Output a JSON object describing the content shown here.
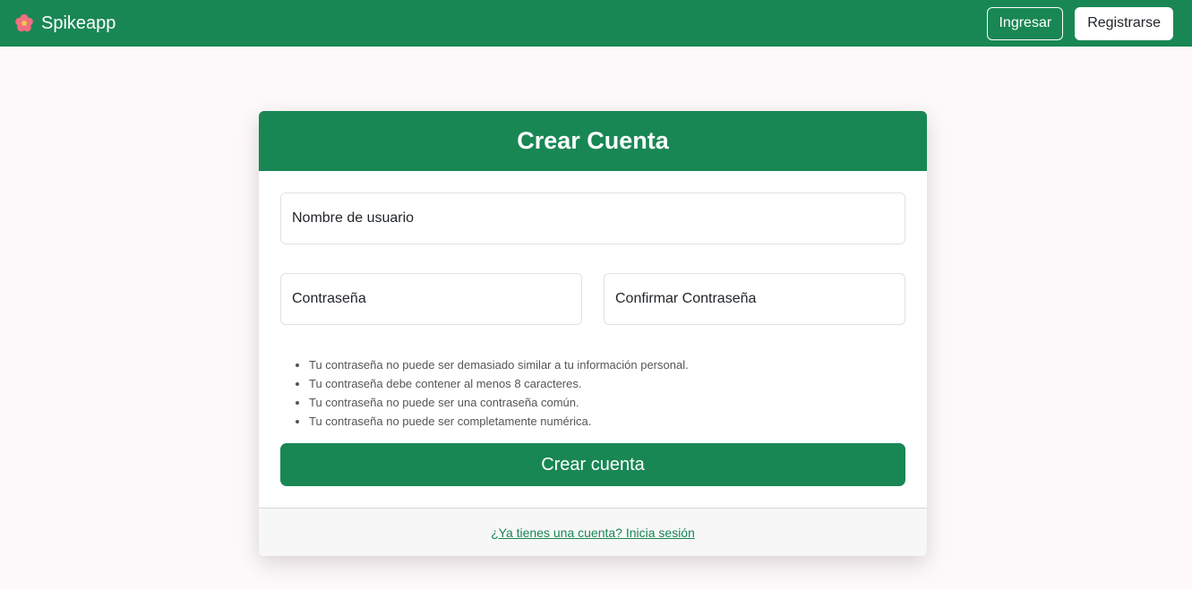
{
  "navbar": {
    "brand": "Spikeapp",
    "brand_icon": "flower-icon",
    "login_label": "Ingresar",
    "register_label": "Registrarse"
  },
  "colors": {
    "primary": "#198754",
    "background": "#fdf8f9",
    "flower": "#f07080"
  },
  "card": {
    "title": "Crear Cuenta",
    "fields": {
      "username_placeholder": "Nombre de usuario",
      "password_placeholder": "Contraseña",
      "confirm_placeholder": "Confirmar Contraseña"
    },
    "password_hints": [
      "Tu contraseña no puede ser demasiado similar a tu información personal.",
      "Tu contraseña debe contener al menos 8 caracteres.",
      "Tu contraseña no puede ser una contraseña común.",
      "Tu contraseña no puede ser completamente numérica."
    ],
    "submit_label": "Crear cuenta",
    "footer_link": "¿Ya tienes una cuenta? Inicia sesión"
  }
}
